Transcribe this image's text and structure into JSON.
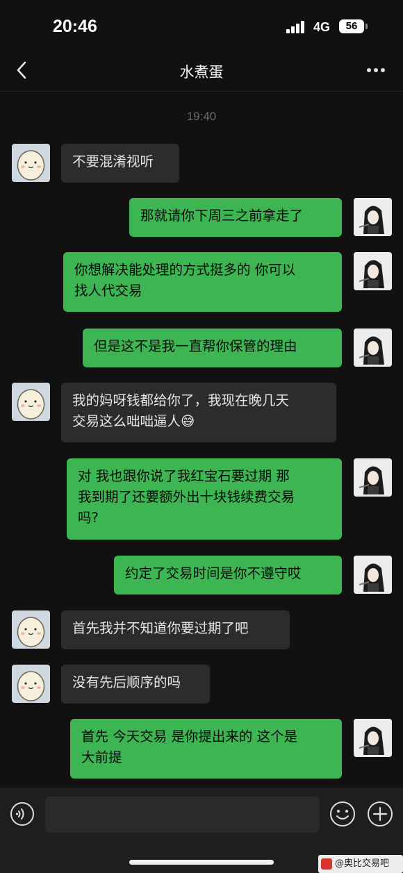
{
  "status_bar": {
    "time": "20:46",
    "network": "4G",
    "battery": "56"
  },
  "nav": {
    "title": "水煮蛋"
  },
  "chat": {
    "timestamp": "19:40",
    "messages": [
      {
        "side": "in",
        "text": "不要混淆视听"
      },
      {
        "side": "out",
        "text": "那就请你下周三之前拿走了"
      },
      {
        "side": "out",
        "text": "你想解决能处理的方式挺多的 你可以\n找人代交易"
      },
      {
        "side": "out",
        "text": "但是这不是我一直帮你保管的理由"
      },
      {
        "side": "in",
        "text": "我的妈呀钱都给你了，我现在晚几天\n交易这么咄咄逼人😅"
      },
      {
        "side": "out",
        "text": "对 我也跟你说了我红宝石要过期 那\n我到期了还要额外出十块钱续费交易\n吗?"
      },
      {
        "side": "out",
        "text": "约定了交易时间是你不遵守哎"
      },
      {
        "side": "in",
        "text": "首先我并不知道你要过期了吧"
      },
      {
        "side": "in",
        "text": "没有先后顺序的吗"
      },
      {
        "side": "out",
        "text": "首先 今天交易 是你提出来的 这个是\n大前提"
      }
    ]
  },
  "input_bar": {
    "message_value": ""
  },
  "watermark": {
    "text": "@奥比交易吧"
  },
  "colors": {
    "outgoing_bubble": "#3cb552",
    "incoming_bubble": "#2c2c2c",
    "background": "#111111"
  }
}
